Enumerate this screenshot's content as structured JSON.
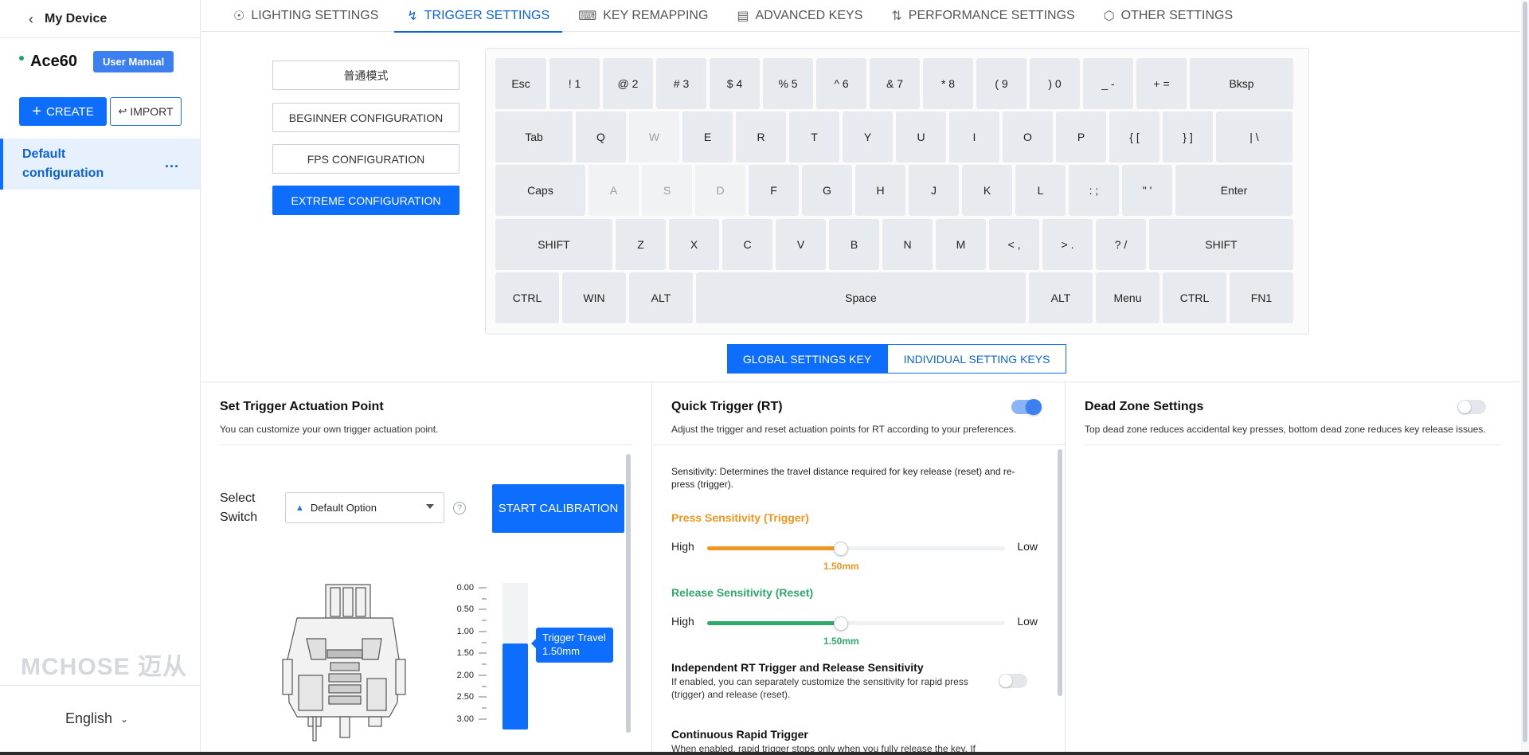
{
  "sidebar": {
    "back_title": "My Device",
    "device_name": "Ace60",
    "manual_label": "User Manual",
    "create_label": "CREATE",
    "import_label": "IMPORT",
    "config_label": "Default configuration",
    "more_label": "...",
    "logo_text": "MCHOSE 迈从",
    "language": "English"
  },
  "tabs": [
    {
      "label": "LIGHTING SETTINGS",
      "icon": "bulb-icon"
    },
    {
      "label": "TRIGGER SETTINGS",
      "icon": "bolt-icon"
    },
    {
      "label": "KEY REMAPPING",
      "icon": "keyboard-icon"
    },
    {
      "label": "ADVANCED KEYS",
      "icon": "advanced-keys-icon"
    },
    {
      "label": "PERFORMANCE SETTINGS",
      "icon": "sliders-icon"
    },
    {
      "label": "OTHER SETTINGS",
      "icon": "gear-icon"
    }
  ],
  "modes": [
    "普通模式",
    "BEGINNER CONFIGURATION",
    "FPS CONFIGURATION",
    "EXTREME CONFIGURATION"
  ],
  "keyboard": {
    "rows": [
      [
        {
          "l": "Esc",
          "w": 64
        },
        {
          "l": "! 1",
          "w": 63
        },
        {
          "l": "@ 2",
          "w": 63
        },
        {
          "l": "# 3",
          "w": 63
        },
        {
          "l": "$ 4",
          "w": 63
        },
        {
          "l": "% 5",
          "w": 63
        },
        {
          "l": "^ 6",
          "w": 63
        },
        {
          "l": "& 7",
          "w": 63
        },
        {
          "l": "* 8",
          "w": 63
        },
        {
          "l": "( 9",
          "w": 63
        },
        {
          "l": ") 0",
          "w": 63
        },
        {
          "l": "_ -",
          "w": 63
        },
        {
          "l": "+ =",
          "w": 63
        },
        {
          "l": "Bksp",
          "w": 130
        }
      ],
      [
        {
          "l": "Tab",
          "w": 97
        },
        {
          "l": "Q",
          "w": 63
        },
        {
          "l": "W",
          "w": 63,
          "dim": true
        },
        {
          "l": "E",
          "w": 63
        },
        {
          "l": "R",
          "w": 63
        },
        {
          "l": "T",
          "w": 63
        },
        {
          "l": "Y",
          "w": 63
        },
        {
          "l": "U",
          "w": 63
        },
        {
          "l": "I",
          "w": 63
        },
        {
          "l": "O",
          "w": 63
        },
        {
          "l": "P",
          "w": 63
        },
        {
          "l": "{ [",
          "w": 63
        },
        {
          "l": "} ]",
          "w": 63
        },
        {
          "l": "| \\",
          "w": 96
        }
      ],
      [
        {
          "l": "Caps",
          "w": 113
        },
        {
          "l": "A",
          "w": 63,
          "dim": true
        },
        {
          "l": "S",
          "w": 63,
          "dim": true
        },
        {
          "l": "D",
          "w": 63,
          "dim": true
        },
        {
          "l": "F",
          "w": 63
        },
        {
          "l": "G",
          "w": 63
        },
        {
          "l": "H",
          "w": 63
        },
        {
          "l": "J",
          "w": 63
        },
        {
          "l": "K",
          "w": 63
        },
        {
          "l": "L",
          "w": 63
        },
        {
          "l": ": ;",
          "w": 63
        },
        {
          "l": "\" '",
          "w": 63
        },
        {
          "l": "Enter",
          "w": 147
        }
      ],
      [
        {
          "l": "SHIFT",
          "w": 147
        },
        {
          "l": "Z",
          "w": 63
        },
        {
          "l": "X",
          "w": 63
        },
        {
          "l": "C",
          "w": 63
        },
        {
          "l": "V",
          "w": 63
        },
        {
          "l": "B",
          "w": 63
        },
        {
          "l": "N",
          "w": 63
        },
        {
          "l": "M",
          "w": 63
        },
        {
          "l": "< ,",
          "w": 63
        },
        {
          "l": "> .",
          "w": 63
        },
        {
          "l": "? /",
          "w": 63
        },
        {
          "l": "SHIFT",
          "w": 181
        }
      ],
      [
        {
          "l": "CTRL",
          "w": 80
        },
        {
          "l": "WIN",
          "w": 80
        },
        {
          "l": "ALT",
          "w": 80
        },
        {
          "l": "Space",
          "w": 414
        },
        {
          "l": "ALT",
          "w": 80
        },
        {
          "l": "Menu",
          "w": 80
        },
        {
          "l": "CTRL",
          "w": 80
        },
        {
          "l": "FN1",
          "w": 80
        }
      ]
    ]
  },
  "scope": {
    "global_label": "GLOBAL SETTINGS KEY",
    "individual_label": "INDIVIDUAL SETTING KEYS"
  },
  "actuation": {
    "title": "Set Trigger Actuation Point",
    "desc": "You can customize your own trigger actuation point.",
    "select_label": "Select Switch",
    "select_value": "Default Option",
    "help": "?",
    "calibrate_label": "START CALIBRATION",
    "scale": [
      "0.00",
      "0.50",
      "1.00",
      "1.50",
      "2.00",
      "2.50",
      "3.00"
    ],
    "tooltip_title": "Trigger Travel",
    "tooltip_value": "1.50mm",
    "travel_fraction": 0.5
  },
  "rt": {
    "title": "Quick Trigger (RT)",
    "desc": "Adjust the trigger and reset actuation points for RT according to your preferences.",
    "enabled": true,
    "sensitivity_desc": "Sensitivity: Determines the travel distance required for key release (reset) and re-press (trigger).",
    "press_title": "Press Sensitivity (Trigger)",
    "press_color": "#f0961f",
    "press_value": "1.50mm",
    "press_fraction": 0.45,
    "release_title": "Release Sensitivity (Reset)",
    "release_color": "#2ea86b",
    "release_value": "1.50mm",
    "release_fraction": 0.45,
    "high": "High",
    "low": "Low",
    "independent_title": "Independent RT Trigger and Release Sensitivity",
    "independent_desc": "If enabled, you can separately customize the sensitivity for rapid press (trigger) and release (reset).",
    "continuous_title": "Continuous Rapid Trigger",
    "continuous_desc": "When enabled, rapid trigger stops only when you fully release the key. If"
  },
  "deadzone": {
    "title": "Dead Zone Settings",
    "desc": "Top dead zone reduces accidental key presses, bottom dead zone reduces key release issues.",
    "enabled": false
  }
}
